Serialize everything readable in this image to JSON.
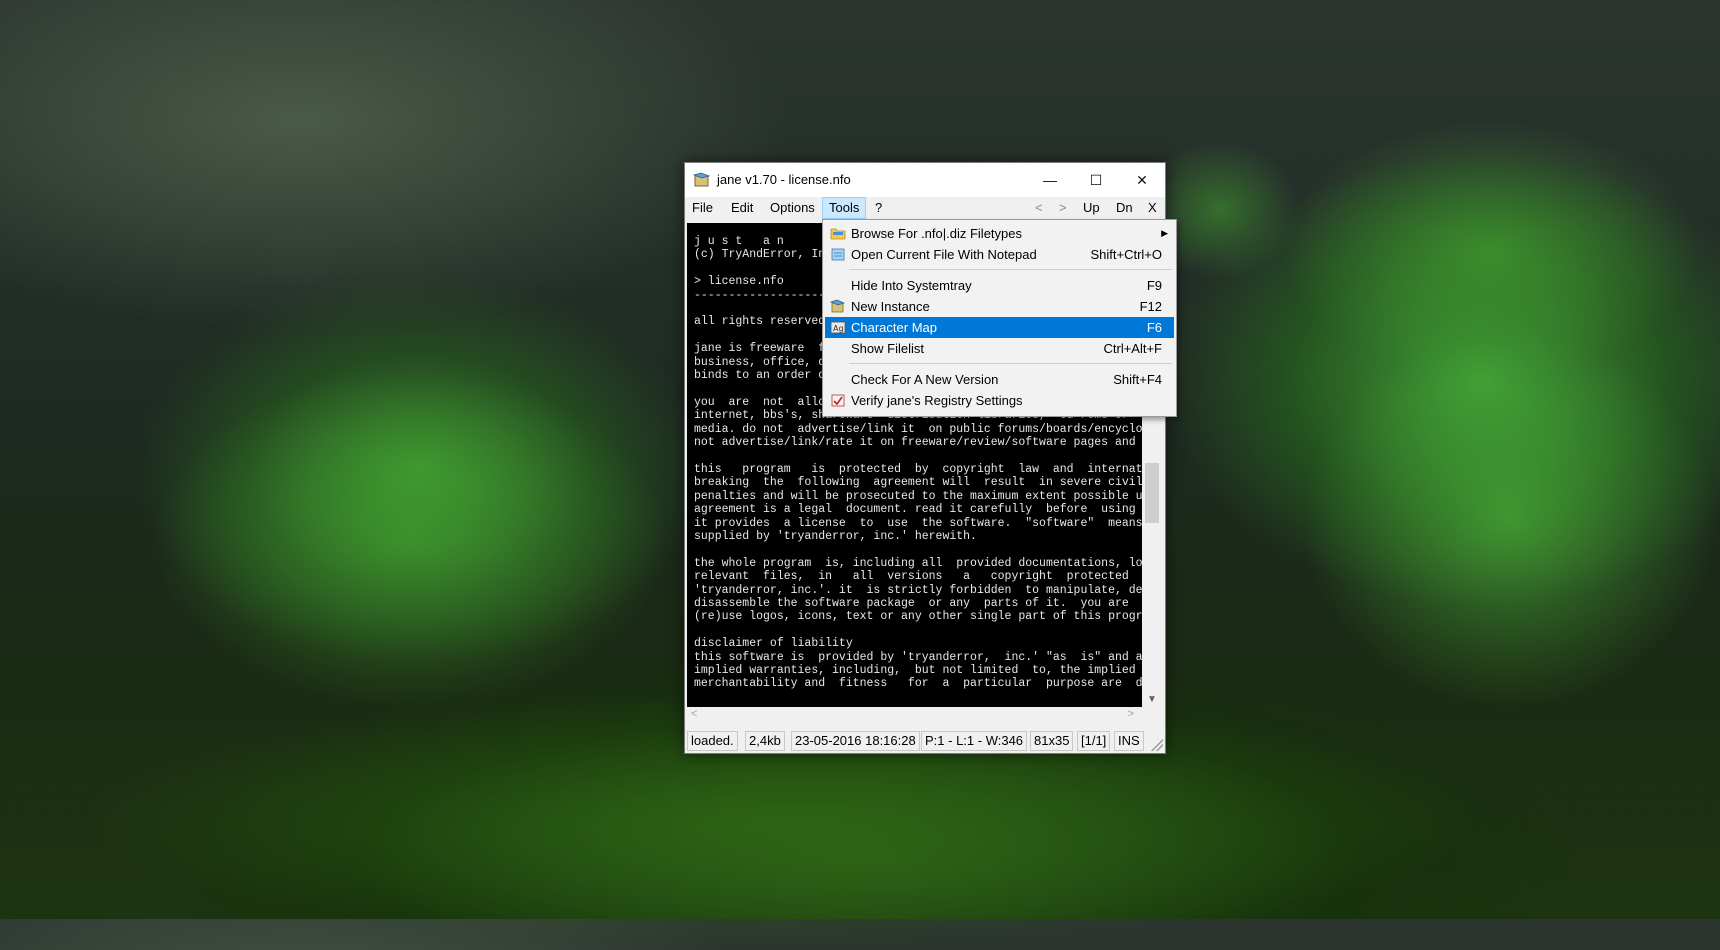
{
  "window": {
    "title": "jane v1.70 - license.nfo",
    "controls": {
      "minimize": "—",
      "maximize": "☐",
      "close": "✕"
    }
  },
  "menubar": {
    "items": [
      "File",
      "Edit",
      "Options",
      "Tools",
      "?"
    ],
    "nav": {
      "prev": "<",
      "next": ">",
      "up": "Up",
      "down": "Dn",
      "close": "X"
    }
  },
  "tools_menu": {
    "items": [
      {
        "label": "Browse For .nfo|.diz Filetypes",
        "shortcut": "",
        "icon": "folder-icon",
        "submenu": true
      },
      {
        "label": "Open Current File With Notepad",
        "shortcut": "Shift+Ctrl+O",
        "icon": "notepad-icon"
      },
      {
        "label": "Hide Into Systemtray",
        "shortcut": "F9"
      },
      {
        "label": "New Instance",
        "shortcut": "F12",
        "icon": "app-icon"
      },
      {
        "label": "Character Map",
        "shortcut": "F6",
        "icon": "character-map-icon",
        "highlighted": true
      },
      {
        "label": "Show Filelist",
        "shortcut": "Ctrl+Alt+F"
      },
      {
        "label": "Check For A New Version",
        "shortcut": "Shift+F4"
      },
      {
        "label": "Verify jane's Registry Settings",
        "shortcut": "",
        "icon": "registry-icon"
      }
    ]
  },
  "document": {
    "text": "j u s t   a n\n(c) TryAndError, Inc.\n\n> license.nfo\n-------------------------------------------------------------------------------\n\nall rights reserved.\n\njane is freeware  for p\nbusiness, office, comme\nbinds to an order of a\n\nyou  are  not  allowed\ninternet, bbs's, shareware  distribution libraries,  cd-roms or  magazine cover\nmedia. do not  advertise/link it  on public forums/boards/encyclopedias, and do\nnot advertise/link/rate it on freeware/review/software pages and similar.\n\nthis   program   is  protected  by  copyright  law  and  international  treaties.\nbreaking  the  following  agreement will  result  in severe civil and  criminal\npenalties and will be prosecuted to the maximum extent possible under law. this\nagreement is a legal  document. read it carefully  before  using  the software.\nit provides  a license  to  use  the software.  \"software\"  means  the program\nsupplied by 'tryanderror, inc.' herewith.\n\nthe whole program  is, including all  provided documentations, logos  and other\nrelevant  files,  in   all  versions   a   copyright  protected   ownership  of\n'tryanderror, inc.'. it  is strictly forbidden  to manipulate, decompile  or to\ndisassemble the software package  or any  parts of it.  you are  not allowed to\n(re)use logos, icons, text or any other single part of this program.\n\ndisclaimer of liability\nthis software is  provided by 'tryanderror,  inc.' \"as  is\" and any  express or\nimplied warranties, including,  but not limited  to, the implied  warranties of\nmerchantability and  fitness   for  a  particular  purpose are  disclaimed.  in"
  },
  "statusbar": [
    "loaded.",
    "2,4kb",
    "23-05-2016 18:16:28",
    "P:1 - L:1 - W:346",
    "81x35",
    "[1/1]",
    "INS"
  ],
  "colors": {
    "highlight": "#0078d7",
    "editor_bg": "#000000",
    "editor_fg": "#e8e8e8"
  }
}
